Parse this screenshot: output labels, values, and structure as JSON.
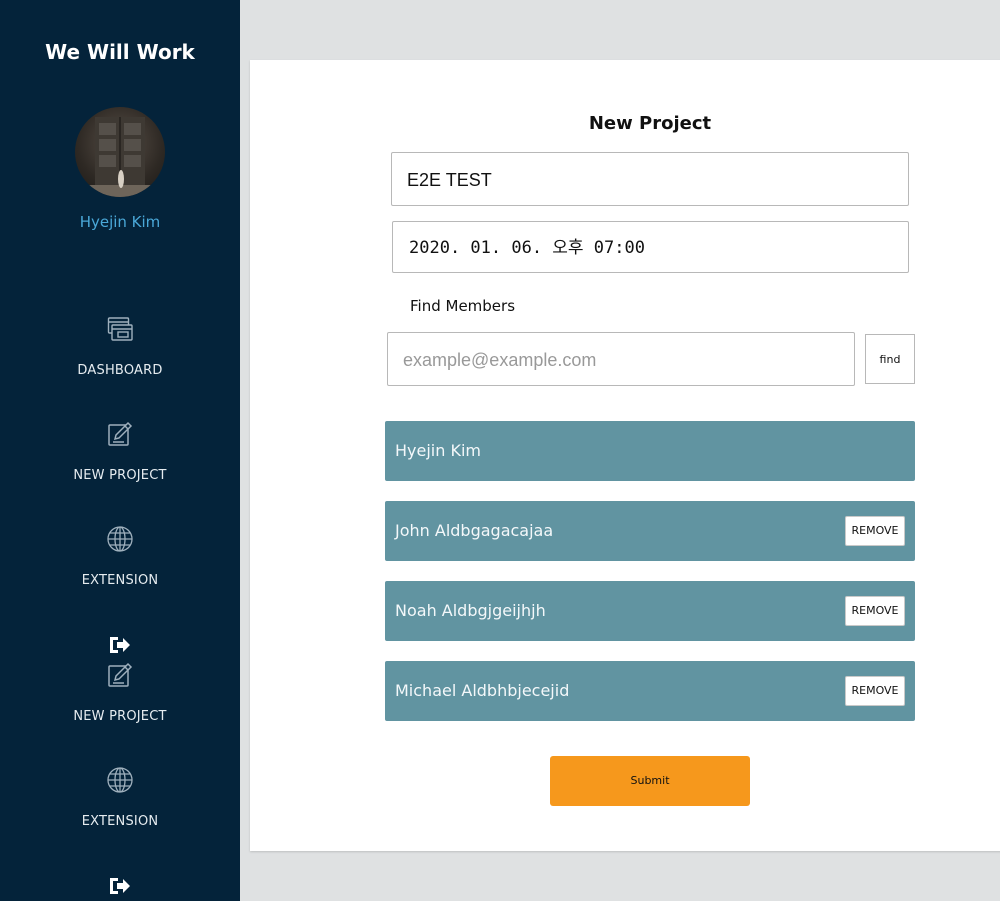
{
  "sidebar": {
    "app_title": "We Will Work",
    "user_name": "Hyejin Kim",
    "items": [
      {
        "label": "DASHBOARD",
        "icon": "dashboard-icon"
      },
      {
        "label": "NEW PROJECT",
        "icon": "edit-icon"
      },
      {
        "label": "EXTENSION",
        "icon": "globe-icon"
      },
      {
        "label": "NEW PROJECT",
        "icon": "edit-icon"
      },
      {
        "label": "EXTENSION",
        "icon": "globe-icon"
      }
    ],
    "logout_icon": "sign-out-icon"
  },
  "form": {
    "title": "New Project",
    "project_name_value": "E2E TEST",
    "project_date_value": "2020. 01. 06. 오후 07:00",
    "find_members_label": "Find Members",
    "member_search_placeholder": "example@example.com",
    "find_button_label": "find",
    "members": [
      {
        "name": "Hyejin Kim"
      },
      {
        "name": "John Aldbgagacajaa",
        "remove_label": "REMOVE"
      },
      {
        "name": "Noah Aldbgjgeijhjh",
        "remove_label": "REMOVE"
      },
      {
        "name": "Michael Aldbhbjecejid",
        "remove_label": "REMOVE"
      }
    ],
    "submit_label": "Submit"
  },
  "colors": {
    "sidebar_bg": "#04233a",
    "user_name": "#4aa8d8",
    "member_row": "#6194a1",
    "submit": "#f6981c",
    "page_bg": "#dfe1e2"
  }
}
